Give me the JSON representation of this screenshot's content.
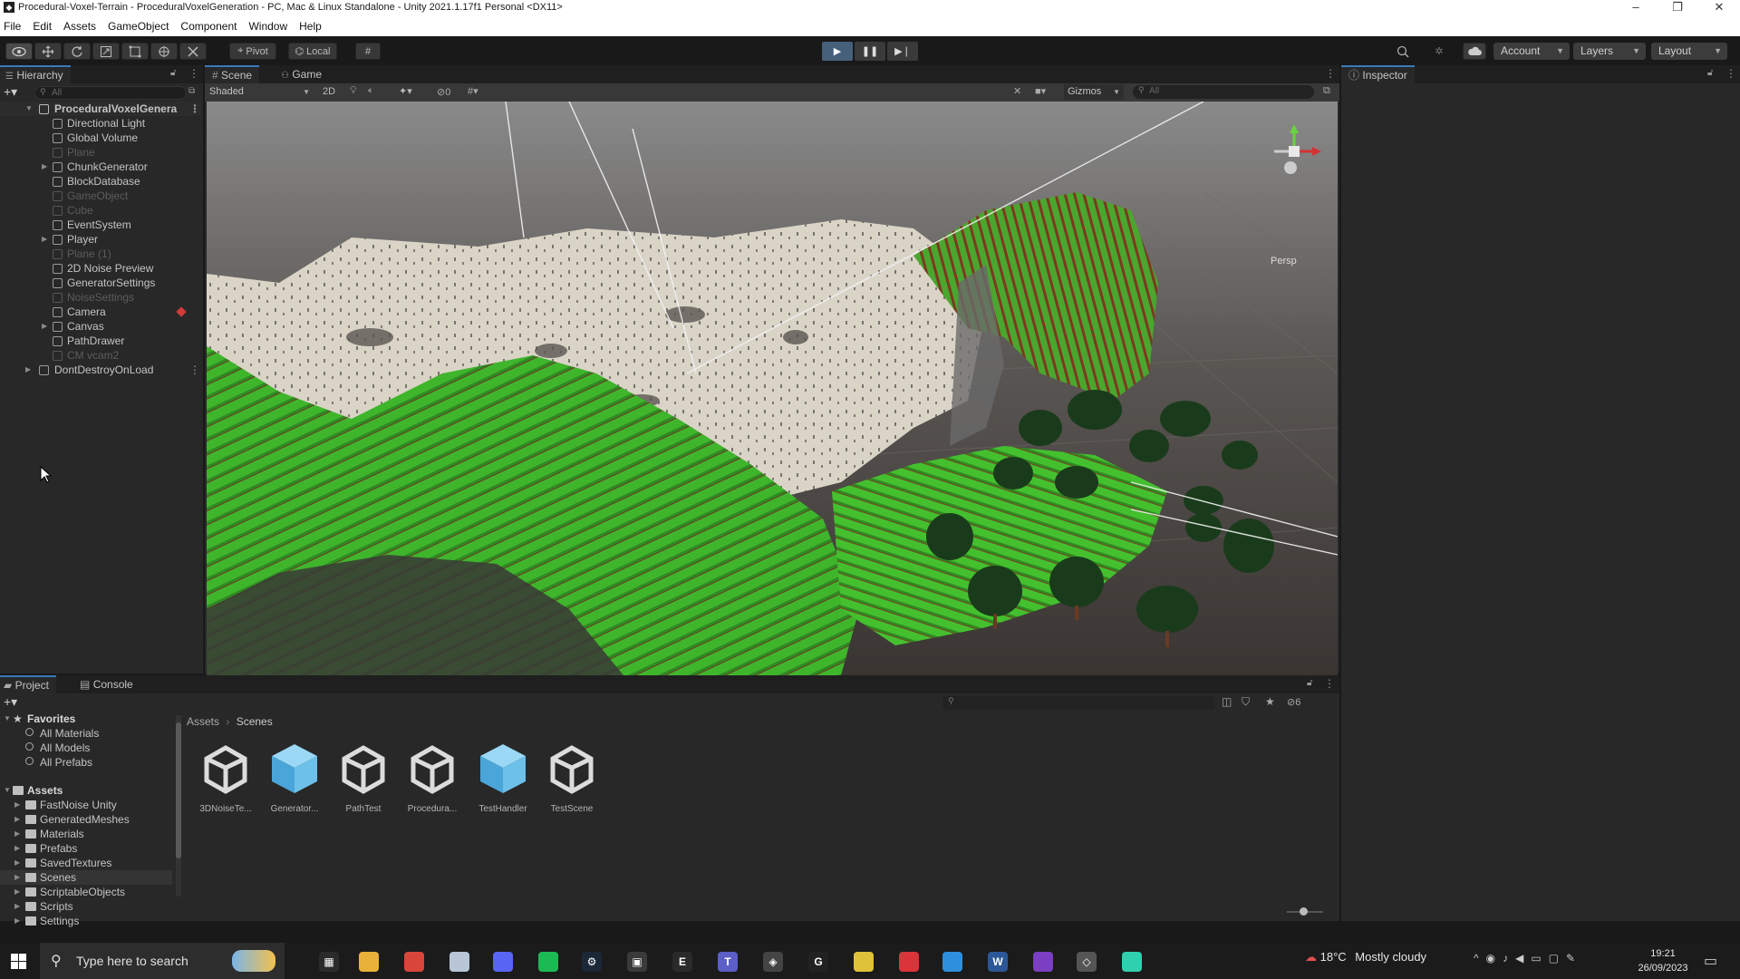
{
  "window": {
    "title": "Procedural-Voxel-Terrain - ProceduralVoxelGeneration - PC, Mac & Linux Standalone - Unity 2021.1.17f1 Personal <DX11>",
    "minimize": "–",
    "maximize": "❐",
    "close": "✕"
  },
  "menu": [
    "File",
    "Edit",
    "Assets",
    "GameObject",
    "Component",
    "Window",
    "Help"
  ],
  "toolbar": {
    "pivot": "Pivot",
    "local": "Local",
    "account": "Account",
    "layers": "Layers",
    "layout": "Layout"
  },
  "hierarchy": {
    "title": "Hierarchy",
    "search_placeholder": "All",
    "scene": "ProceduralVoxelGenera",
    "items": [
      {
        "label": "Directional Light",
        "dim": false,
        "arrow": false
      },
      {
        "label": "Global Volume",
        "dim": false,
        "arrow": false
      },
      {
        "label": "Plane",
        "dim": true,
        "arrow": false
      },
      {
        "label": "ChunkGenerator",
        "dim": false,
        "arrow": true
      },
      {
        "label": "BlockDatabase",
        "dim": false,
        "arrow": false
      },
      {
        "label": "GameObject",
        "dim": true,
        "arrow": false
      },
      {
        "label": "Cube",
        "dim": true,
        "arrow": false
      },
      {
        "label": "EventSystem",
        "dim": false,
        "arrow": false
      },
      {
        "label": "Player",
        "dim": false,
        "arrow": true
      },
      {
        "label": "Plane (1)",
        "dim": true,
        "arrow": false
      },
      {
        "label": "2D Noise Preview",
        "dim": false,
        "arrow": false
      },
      {
        "label": "GeneratorSettings",
        "dim": false,
        "arrow": false
      },
      {
        "label": "NoiseSettings",
        "dim": true,
        "arrow": false
      },
      {
        "label": "Camera",
        "dim": false,
        "arrow": false
      },
      {
        "label": "Canvas",
        "dim": false,
        "arrow": true
      },
      {
        "label": "PathDrawer",
        "dim": false,
        "arrow": false
      },
      {
        "label": "CM vcam2",
        "dim": true,
        "arrow": false
      }
    ],
    "dont_destroy": "DontDestroyOnLoad"
  },
  "scene_view": {
    "tab_scene": "Scene",
    "tab_game": "Game",
    "shading_mode": "Shaded",
    "mode_2d": "2D",
    "hidden_count": "0",
    "gizmos": "Gizmos",
    "search_placeholder": "All",
    "persp": "Persp"
  },
  "inspector": {
    "title": "Inspector"
  },
  "project": {
    "tab_project": "Project",
    "tab_console": "Console",
    "hidden_count": "6",
    "favorites_label": "Favorites",
    "favorites": [
      "All Materials",
      "All Models",
      "All Prefabs"
    ],
    "assets_label": "Assets",
    "folders": [
      "FastNoise Unity",
      "GeneratedMeshes",
      "Materials",
      "Prefabs",
      "SavedTextures",
      "Scenes",
      "ScriptableObjects",
      "Scripts",
      "Settings"
    ],
    "selected_folder": "Scenes",
    "breadcrumb_root": "Assets",
    "breadcrumb_current": "Scenes",
    "assets": [
      {
        "label": "3DNoiseTe...",
        "icon": "unity-scene-icon"
      },
      {
        "label": "Generator...",
        "icon": "prefab-cube-icon"
      },
      {
        "label": "PathTest",
        "icon": "unity-scene-icon"
      },
      {
        "label": "Procedura...",
        "icon": "unity-scene-icon"
      },
      {
        "label": "TestHandler",
        "icon": "prefab-cube-icon"
      },
      {
        "label": "TestScene",
        "icon": "unity-scene-icon"
      }
    ]
  },
  "taskbar": {
    "search_placeholder": "Type here to search",
    "temperature": "18°C",
    "weather": "Mostly cloudy",
    "time": "19:21",
    "date": "26/09/2023"
  },
  "colors": {
    "accent_play": "#46607c",
    "grass": "#3cb02a",
    "snow": "#d8d2c6",
    "dirt": "#6a3a22"
  }
}
